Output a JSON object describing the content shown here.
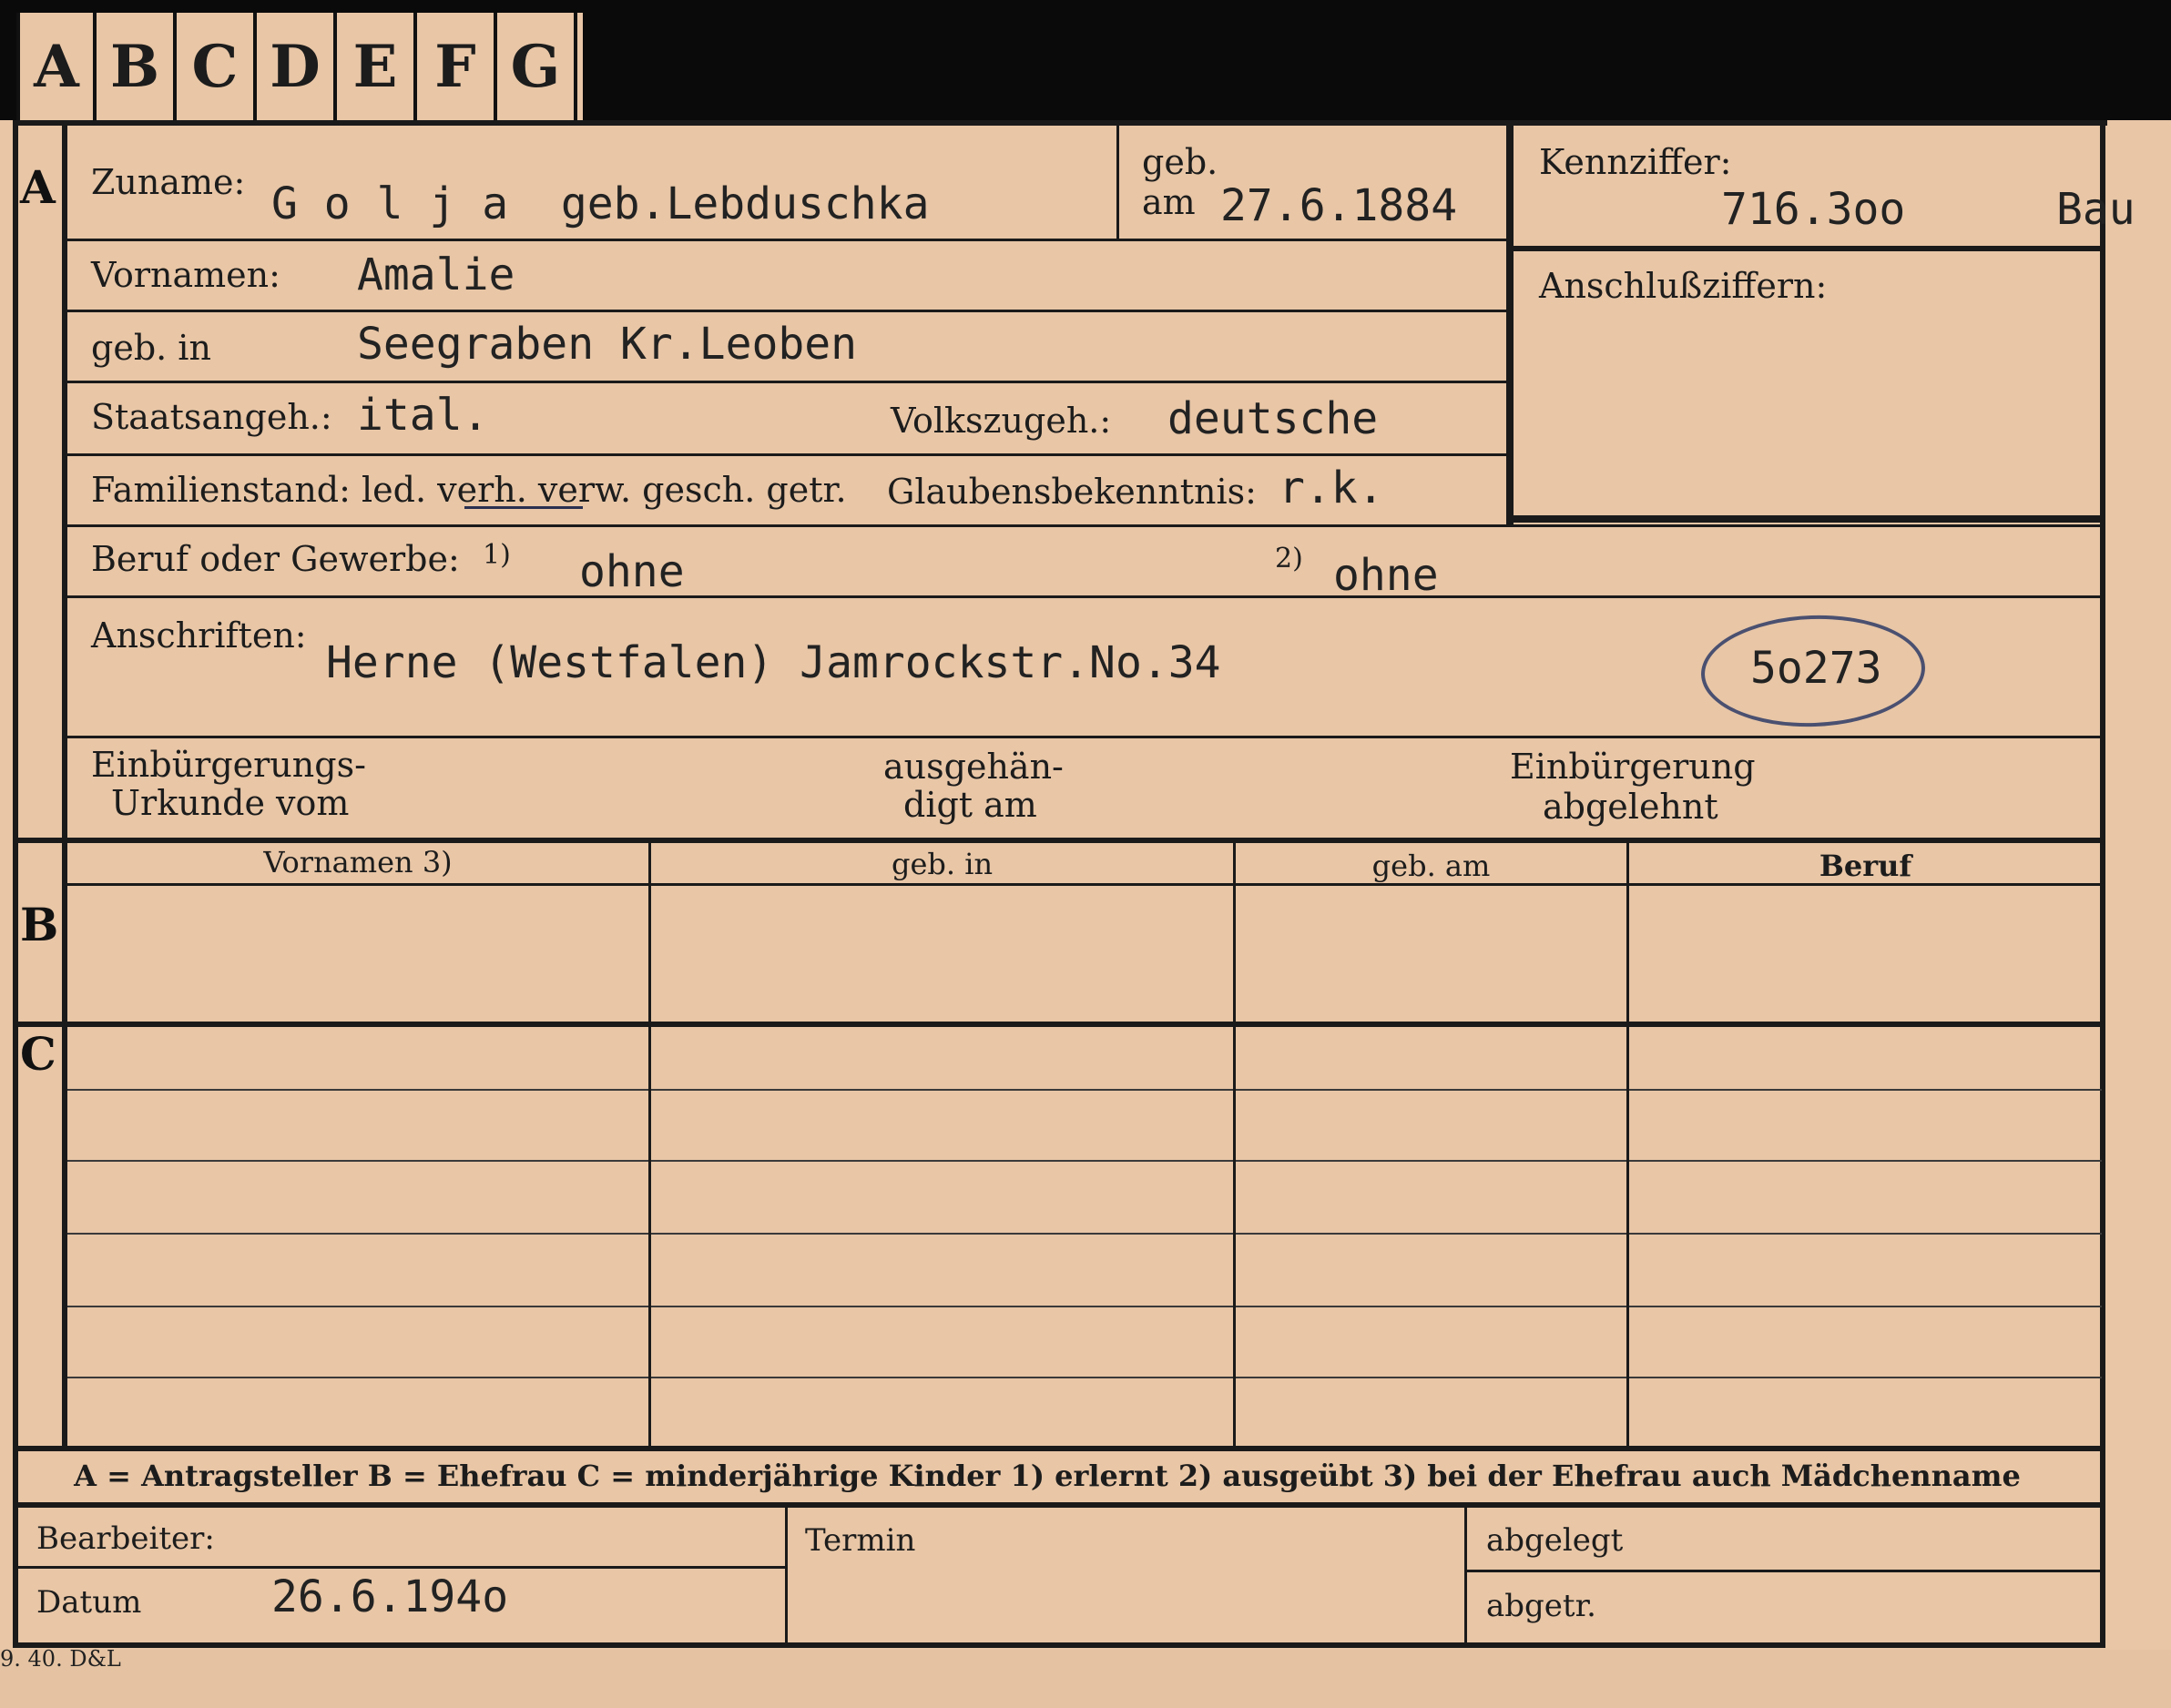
{
  "tabs": [
    "A",
    "B",
    "C",
    "D",
    "E",
    "F",
    "G"
  ],
  "sections": {
    "a": "A",
    "b": "B",
    "c": "C"
  },
  "labels": {
    "zuname": "Zuname:",
    "geb": "geb.",
    "am": "am",
    "kennziffer": "Kennziffer:",
    "vornamen": "Vornamen:",
    "anschlussziffern": "Anschlußziffern:",
    "geb_in": "geb. in",
    "staatsangeh": "Staatsangeh.:",
    "volkszugeh": "Volkszugeh.:",
    "familienstand": "Familienstand: led. verh. verw. gesch. getr.",
    "glaubensbekenntnis": "Glaubensbekenntnis:",
    "beruf": "Beruf oder Gewerbe:",
    "beruf_note1": "1)",
    "beruf_note2": "2)",
    "anschriften": "Anschriften:",
    "einbuergerung_urkunde_1": "Einbürgerungs-",
    "einbuergerung_urkunde_2": "Urkunde vom",
    "ausgehaendigt_1": "ausgehän-",
    "ausgehaendigt_2": "digt am",
    "einbuergerung_abgelehnt_1": "Einbürgerung",
    "einbuergerung_abgelehnt_2": "abgelehnt",
    "bearbeiter": "Bearbeiter:",
    "datum": "Datum",
    "termin": "Termin",
    "abgelegt": "abgelegt",
    "abgetr": "abgetr."
  },
  "values": {
    "zuname": "G o l j a  geb.Lebduschka",
    "geb_am": "27.6.1884",
    "kennziffer": "716.3oo",
    "kennziffer_suffix": "Bau",
    "vornamen": "Amalie",
    "geb_in": "Seegraben Kr.Leoben",
    "staatsangeh": "ital.",
    "volkszugeh": "deutsche",
    "glaubensbekenntnis": "r.k.",
    "beruf_erlernt": "ohne",
    "beruf_ausgeuebt": "ohne",
    "anschrift": "Herne (Westfalen) Jamrockstr.No.34",
    "circled_number": "5o273",
    "datum": "26.6.194o"
  },
  "table": {
    "columns": [
      "Vornamen 3)",
      "geb. in",
      "geb. am",
      "Beruf"
    ]
  },
  "legend": "A = Antragsteller   B = Ehefrau   C = minderjährige Kinder   1) erlernt   2) ausgeübt   3) bei der Ehefrau auch Mädchenname",
  "footer_code": "9. 40. D&L"
}
